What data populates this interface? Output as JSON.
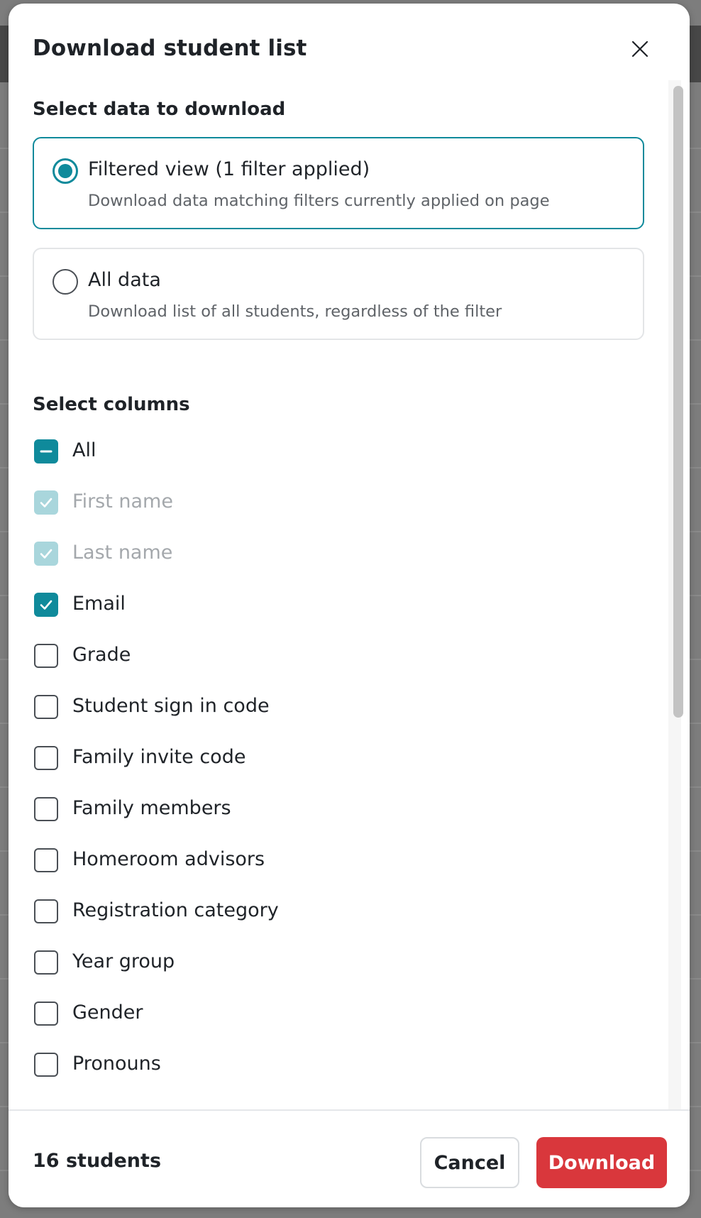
{
  "modal": {
    "title": "Download student list",
    "close_icon": "close-icon"
  },
  "data_section": {
    "heading": "Select data to download",
    "options": [
      {
        "label": "Filtered view (1 filter applied)",
        "description": "Download data matching filters currently applied on page",
        "selected": true
      },
      {
        "label": "All data",
        "description": "Download list of all students, regardless of the filter",
        "selected": false
      }
    ]
  },
  "columns_section": {
    "heading": "Select columns",
    "items": [
      {
        "label": "All",
        "state": "partial"
      },
      {
        "label": "First name",
        "state": "checked-disabled"
      },
      {
        "label": "Last name",
        "state": "checked-disabled"
      },
      {
        "label": "Email",
        "state": "checked"
      },
      {
        "label": "Grade",
        "state": "unchecked"
      },
      {
        "label": "Student sign in code",
        "state": "unchecked"
      },
      {
        "label": "Family invite code",
        "state": "unchecked"
      },
      {
        "label": "Family members",
        "state": "unchecked"
      },
      {
        "label": "Homeroom advisors",
        "state": "unchecked"
      },
      {
        "label": "Registration category",
        "state": "unchecked"
      },
      {
        "label": "Year group",
        "state": "unchecked"
      },
      {
        "label": "Gender",
        "state": "unchecked"
      },
      {
        "label": "Pronouns",
        "state": "unchecked"
      }
    ]
  },
  "footer": {
    "count": "16 students",
    "cancel_label": "Cancel",
    "download_label": "Download"
  },
  "colors": {
    "accent": "#0f8a9b",
    "accent_disabled": "#a9d6dc",
    "primary_button": "#d9373c"
  }
}
